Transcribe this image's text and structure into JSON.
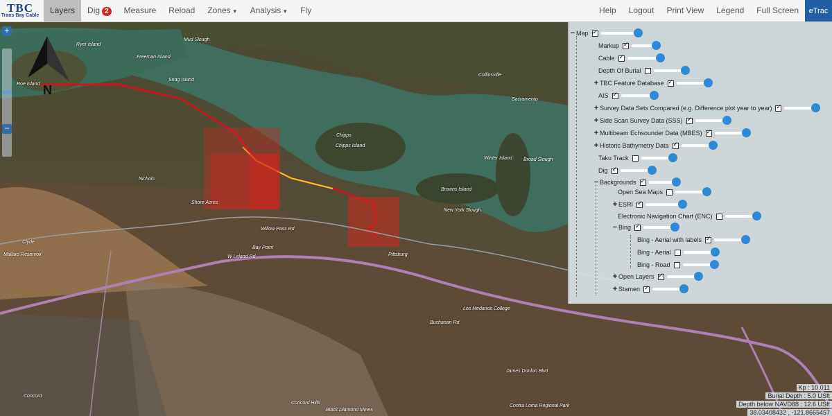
{
  "logo": {
    "title": "TBC",
    "subtitle": "Trans Bay Cable"
  },
  "nav": {
    "layers": "Layers",
    "dig": "Dig",
    "dig_count": "2",
    "measure": "Measure",
    "reload": "Reload",
    "zones": "Zones",
    "analysis": "Analysis",
    "fly": "Fly",
    "help": "Help",
    "logout": "Logout",
    "print": "Print View",
    "legend": "Legend",
    "fullscreen": "Full Screen",
    "brand": "eTrac"
  },
  "zoom": {
    "plus": "+",
    "minus": "−"
  },
  "north": "N",
  "layers": {
    "map": "Map",
    "markup": "Markup",
    "cable": "Cable",
    "depth": "Depth Of Burial",
    "tbc": "TBC Feature Database",
    "ais": "AIS",
    "survey": "Survey Data Sets Compared (e.g. Difference plot year to year)",
    "sss": "Side Scan Survey Data (SSS)",
    "mbes": "Multibeam Echsounder Data (MBES)",
    "bathy": "Historic Bathymetry Data",
    "taku": "Taku Track",
    "dig": "Dig",
    "backgrounds": "Backgrounds",
    "osm": "Open Sea Maps",
    "esri": "ESRI",
    "enc": "Electronic Navigation Chart (ENC)",
    "bing": "Bing",
    "bing_labels": "Bing - Aerial with labels",
    "bing_aerial": "Bing - Aerial",
    "bing_road": "Bing - Road",
    "openlayers": "Open Layers",
    "stamen": "Stamen"
  },
  "status": {
    "kp": "Kp : 10.011",
    "burial": "Burial Depth : 5.0 USft",
    "depth": "Depth below NAVD88 : 12.6 USft",
    "coords": "38.03408432 , -121.8665457"
  },
  "places": {
    "ryer": "Ryer Island",
    "roe": "Roe Island",
    "freeman": "Freeman Island",
    "snag": "Snag Island",
    "mud": "Mud Slough",
    "collinsville": "Collinsville",
    "sacramento": "Sacramento",
    "chipps1": "Chipps",
    "chipps2": "Chipps Island",
    "winter": "Winter Island",
    "broad": "Broad Slough",
    "browns": "Browns Island",
    "newyork": "New York Slough",
    "nichols": "Nichols",
    "shore": "Shore Acres",
    "baypoint": "Bay Point",
    "pittsburg": "Pittsburg",
    "concord": "Concord",
    "clyde": "Clyde",
    "mallard": "Mallard Reservoir",
    "willow": "Willow Pass Rd",
    "wleland": "W Leland Rd",
    "medanos": "Los Medanos College",
    "concordhills": "Concord Hills",
    "contraloma": "Contra Loma Regional Park",
    "blackdiamond": "Black Diamond Mines",
    "buchanan": "Buchanan Rd",
    "jamesdonlon": "James Donlon Blvd"
  },
  "colors": {
    "accent": "#2c8ad6",
    "cable": "#c8181e",
    "survey": "#d9261c"
  }
}
